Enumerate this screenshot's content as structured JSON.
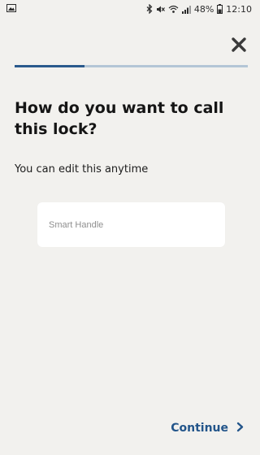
{
  "status_bar": {
    "battery": "48%",
    "time": "12:10",
    "icons": [
      "image-notification-icon",
      "bluetooth-icon",
      "mute-icon",
      "wifi-icon",
      "signal-icon",
      "battery-icon"
    ]
  },
  "header": {
    "close_icon": "close-icon"
  },
  "progress": {
    "fraction": 0.3
  },
  "main": {
    "title": "How do you want to call this lock?",
    "subtitle": "You can edit this anytime",
    "name_input": {
      "value": "",
      "placeholder": "Smart Handle"
    }
  },
  "footer": {
    "continue_label": "Continue",
    "continue_icon": "chevron-right-icon"
  },
  "colors": {
    "background": "#f2f1ee",
    "accent": "#23558a",
    "progress_fill": "#2a5a8c",
    "progress_track": "#b4c6d6"
  }
}
